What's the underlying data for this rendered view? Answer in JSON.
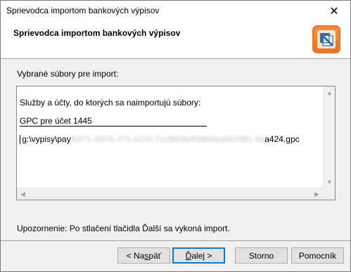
{
  "window": {
    "title": "Sprievodca importom bankových výpisov",
    "close_glyph": "✕"
  },
  "header": {
    "heading": "Sprievodca importom bankových výpisov",
    "logo_icon": "import-wizard-icon",
    "logo_colors": {
      "outer": "#e8762b",
      "inner": "#fbe3c8",
      "mark": "#2a6fb0"
    }
  },
  "main": {
    "selected_label": "Vybrané súbory pre import:",
    "textbox_lines": [
      "Služby a účty, do ktorých sa naimportujú súbory:",
      "GPC pre účet 1445",
      " g:\\vypisy\\pay",
      "a424.gpc"
    ],
    "redacted_text": "B3F5-33F8-7F5-4216-7ccf9d3b4f38b0edb82f8f1-8d",
    "warning": "Upozornenie: Po stlačení tlačidla Ďalší sa vykoná import."
  },
  "buttons": {
    "back": {
      "prefix": "< Na",
      "accel": "s",
      "suffix": "päť"
    },
    "next": {
      "accel": "Ď",
      "suffix": "alej >"
    },
    "cancel": "Storno",
    "help": "Pomocník"
  }
}
